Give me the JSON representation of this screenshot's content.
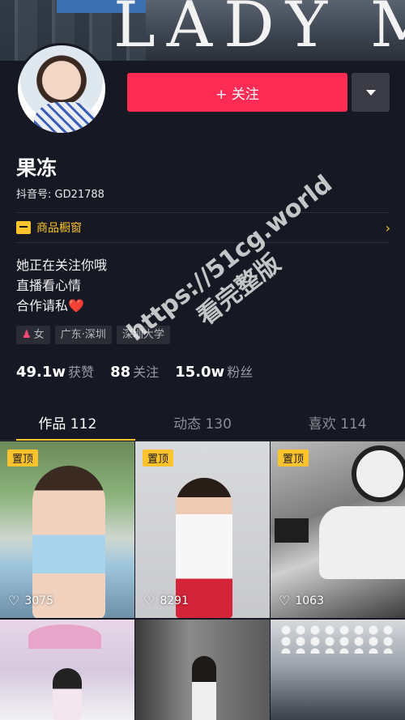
{
  "cover": {
    "brand_text": "LADY M"
  },
  "actions": {
    "follow_label": "+ 关注"
  },
  "profile": {
    "nickname": "果冻",
    "douyin_id": "抖音号: GD21788"
  },
  "shop": {
    "label": "商品橱窗",
    "arrow": "›"
  },
  "bio": {
    "line1": "她正在关注你哦",
    "line2": "直播看心情",
    "line3": "合作请私",
    "heart": "❤️"
  },
  "tags": {
    "gender": "女",
    "location": "广东·深圳",
    "school": "深圳大学"
  },
  "stats": {
    "likes_value": "49.1w",
    "likes_label": "获赞",
    "following_value": "88",
    "following_label": "关注",
    "fans_value": "15.0w",
    "fans_label": "粉丝"
  },
  "tabs": [
    {
      "label": "作品 112",
      "active": true
    },
    {
      "label": "动态 130",
      "active": false
    },
    {
      "label": "喜欢 114",
      "active": false
    }
  ],
  "videos": [
    {
      "pinned": true,
      "pin_label": "置顶",
      "likes": "3075"
    },
    {
      "pinned": true,
      "pin_label": "置顶",
      "likes": "8291"
    },
    {
      "pinned": true,
      "pin_label": "置顶",
      "likes": "1063"
    }
  ],
  "watermark": {
    "line1": "https://51cg.world",
    "line2": "看完整版"
  },
  "colors": {
    "background": "#161823",
    "follow": "#fe2c55",
    "accent_yellow": "#fcc32c"
  },
  "icons": {
    "more": "chevron-down-icon",
    "shop": "shop-icon",
    "heart": "heart-outline-icon"
  }
}
